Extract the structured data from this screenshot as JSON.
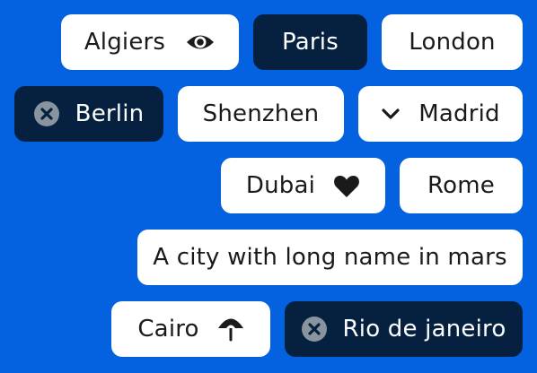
{
  "chips": [
    {
      "label": "Algiers",
      "icon": "eye-icon",
      "icon_position": "trailing",
      "selected": false
    },
    {
      "label": "Paris",
      "icon": null,
      "selected": true
    },
    {
      "label": "London",
      "icon": null,
      "selected": false
    },
    {
      "label": "Berlin",
      "icon": "close-circle-icon",
      "icon_position": "leading",
      "selected": true
    },
    {
      "label": "Shenzhen",
      "icon": null,
      "selected": false
    },
    {
      "label": "Madrid",
      "icon": "chevron-down-icon",
      "icon_position": "leading",
      "selected": false
    },
    {
      "label": "Dubai",
      "icon": "heart-icon",
      "icon_position": "trailing",
      "selected": false
    },
    {
      "label": "Rome",
      "icon": null,
      "selected": false
    },
    {
      "label": "A city with long name in mars",
      "icon": null,
      "selected": false
    },
    {
      "label": "Cairo",
      "icon": "umbrella-icon",
      "icon_position": "trailing",
      "selected": false
    },
    {
      "label": "Rio de janeiro",
      "icon": "close-circle-icon",
      "icon_position": "leading",
      "selected": true
    }
  ],
  "colors": {
    "background": "#0461e0",
    "chip_light": "#ffffff",
    "chip_dark": "#05213f",
    "text_dark": "#1a1a1a",
    "text_light": "#ffffff",
    "icon_close_bg": "#8a949e"
  }
}
